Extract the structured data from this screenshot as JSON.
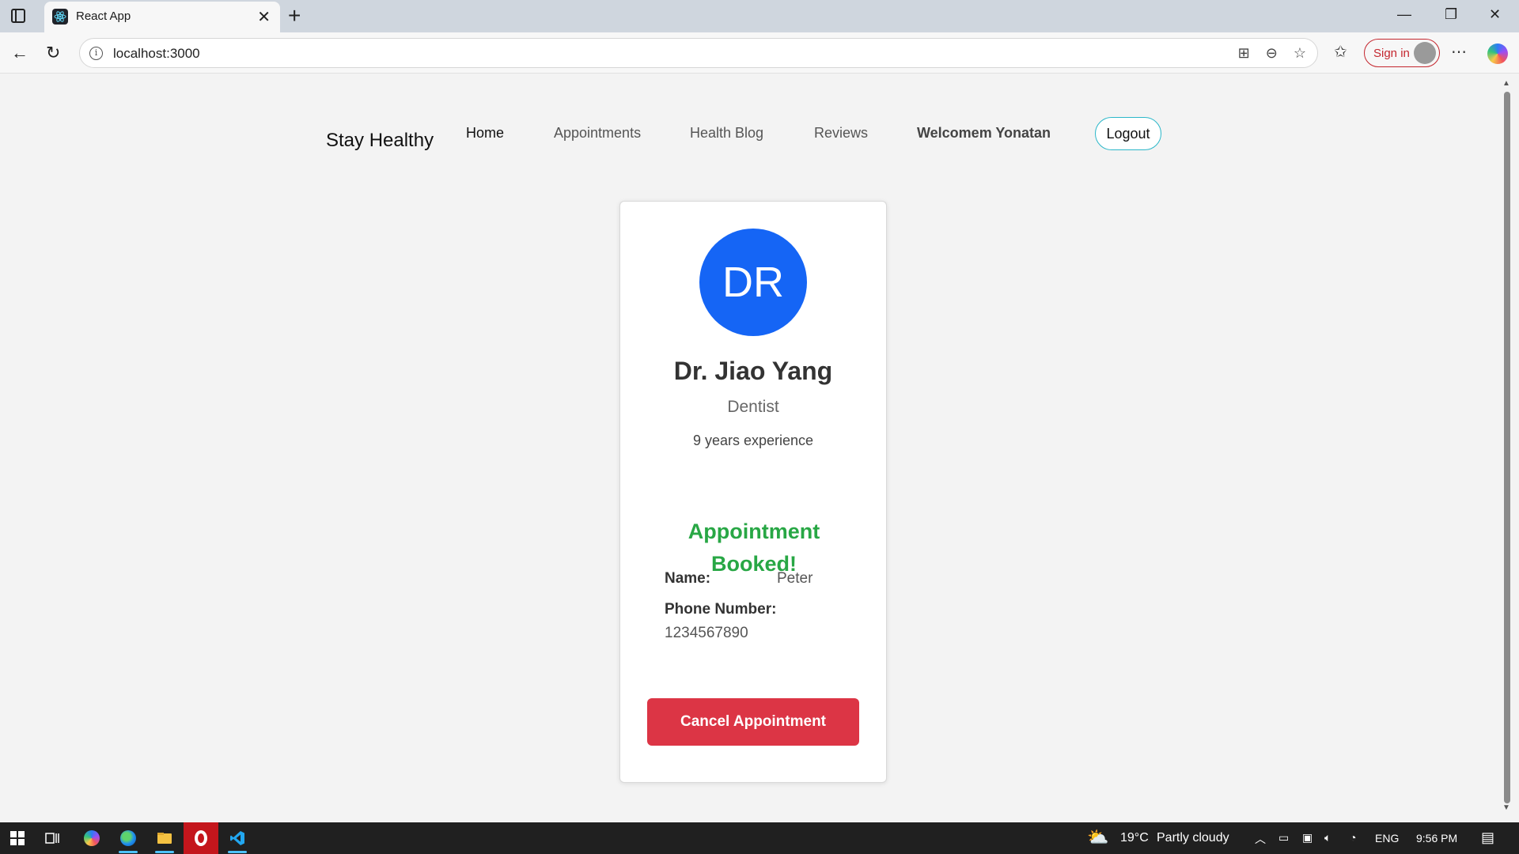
{
  "browser": {
    "tab_title": "React App",
    "url": "localhost:3000",
    "signin_label": "Sign in"
  },
  "site": {
    "brand": "Stay Healthy",
    "nav": {
      "home": "Home",
      "appointments": "Appointments",
      "health_blog": "Health Blog",
      "reviews": "Reviews"
    },
    "welcome": "Welcomem Yonatan",
    "logout": "Logout"
  },
  "doctor": {
    "initials": "DR",
    "name": "Dr. Jiao Yang",
    "specialty": "Dentist",
    "experience": "9 years experience"
  },
  "booking": {
    "status": "Appointment Booked!",
    "name_label": "Name:",
    "name_value": "Peter",
    "phone_label": "Phone Number:",
    "phone_value": "1234567890",
    "cancel_label": "Cancel Appointment"
  },
  "taskbar": {
    "temperature": "19°C",
    "weather": "Partly cloudy",
    "language": "ENG",
    "time": "9:56 PM"
  },
  "colors": {
    "avatar": "#1565f5",
    "booked": "#28a745",
    "cancel": "#dc3545",
    "logout_border": "#2bb7c9"
  }
}
